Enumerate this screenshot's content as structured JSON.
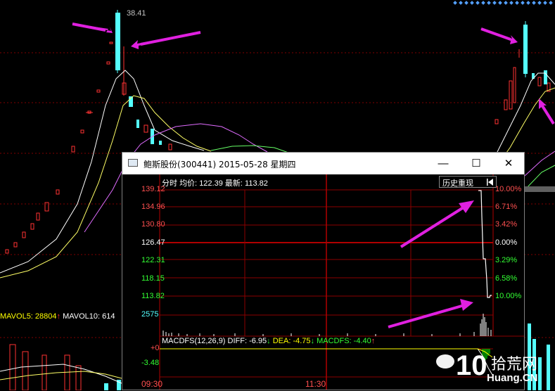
{
  "background_chart": {
    "price_peak_label": "38.41",
    "volume_label_mavol5": "MAVOL5: 28804",
    "volume_label_mavol5_arrow": "↑",
    "volume_label_mavol10": "MAVOL10: 614"
  },
  "window": {
    "title": "鲍斯股份(300441) 2015-05-28 星期四",
    "minimize_glyph": "—",
    "maximize_glyph": "☐",
    "close_glyph": "✕",
    "replay_button": "历史重现",
    "replay_icon": "arrow-left-icon",
    "info": {
      "mode": "分时",
      "avg_label": "均价:",
      "avg_value": "122.39",
      "latest_label": "最新:",
      "latest_value": "113.82"
    },
    "price_labels": [
      "139.12",
      "134.96",
      "130.80",
      "126.47",
      "122.31",
      "118.15",
      "113.82"
    ],
    "pct_labels": [
      "10.00%",
      "6.71%",
      "3.42%",
      "0.00%",
      "3.29%",
      "6.58%",
      "10.00%"
    ],
    "volume_label": "2575",
    "macd": {
      "title": "MACDFS(12,26,9)",
      "diff": "DIFF: -6.95",
      "diff_arrow": "↓",
      "dea": "DEA: -4.75",
      "dea_arrow": "↓",
      "macdfs": "MACDFS: -4.40",
      "macdfs_arrow": "↑",
      "axis_top": "+0",
      "axis_bottom": "-3.48"
    },
    "time_labels": [
      "09:30",
      "11:30"
    ]
  },
  "watermark": {
    "text_cn": "拾荒网",
    "text_en": "Huang.CN",
    "number": "10"
  },
  "colors": {
    "up": "#ff3232",
    "down": "#54ffff",
    "grid": "#8b0000",
    "arrow": "#e020e0",
    "white": "#ffffff",
    "yellow": "#ffff00",
    "green": "#00ff00"
  }
}
